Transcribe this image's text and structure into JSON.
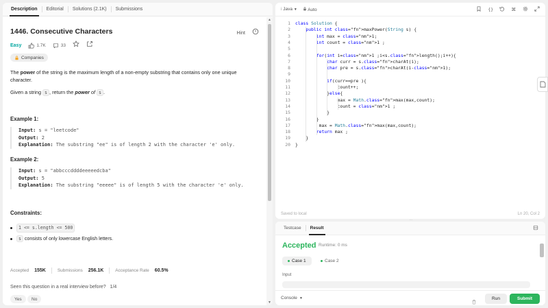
{
  "left_tabs": [
    {
      "label": "Description"
    },
    {
      "label": "Editorial"
    },
    {
      "label": "Solutions (2.1K)"
    },
    {
      "label": "Submissions"
    }
  ],
  "problem": {
    "title": "1446. Consecutive Characters",
    "hint": "Hint",
    "difficulty": "Easy",
    "likes": "1.7K",
    "comments": "33",
    "companies_chip": "Companies",
    "desc1_pre": "The ",
    "desc1_bold": "power",
    "desc1_post": " of the string is the maximum length of a non-empty substring that contains only one unique character.",
    "desc2_pre": "Given a string ",
    "desc2_code1": "s",
    "desc2_mid": ", return the ",
    "desc2_bold": "power",
    "desc2_of": " of ",
    "desc2_code2": "s",
    "desc2_end": "."
  },
  "examples": [
    {
      "heading": "Example 1:",
      "input_label": "Input:",
      "input": "s = \"leetcode\"",
      "output_label": "Output:",
      "output": "2",
      "expl_label": "Explanation:",
      "explanation": "The substring \"ee\" is of length 2 with the character 'e' only."
    },
    {
      "heading": "Example 2:",
      "input_label": "Input:",
      "input": "s = \"abbcccddddeeeeedcba\"",
      "output_label": "Output:",
      "output": "5",
      "expl_label": "Explanation:",
      "explanation": "The substring \"eeeee\" is of length 5 with the character 'e' only."
    }
  ],
  "constraints": {
    "heading": "Constraints:",
    "c1": "1 <= s.length <= 500",
    "c2_code": "s",
    "c2_text": " consists of only lowercase English letters."
  },
  "stats": {
    "accepted_label": "Accepted",
    "accepted": "155K",
    "submissions_label": "Submissions",
    "submissions": "256.1K",
    "rate_label": "Acceptance Rate",
    "rate": "60.5%"
  },
  "interview": {
    "question": "Seen this question in a real interview before?",
    "count": "1/4",
    "yes": "Yes",
    "no": "No"
  },
  "editor": {
    "language": "Java",
    "auto": "Auto",
    "saved": "Saved to local",
    "position": "Ln 20, Col 2",
    "lines": [
      "class Solution {",
      "    public int maxPower(String s) {",
      "        int max = 1;",
      "        int count = 1 ;",
      "",
      "        for(int i=1 ;i<s.length();i++){",
      "            char curr = s.charAt(i);",
      "            char pre = s.charAt(i-1);",
      "",
      "            if(curr==pre ){",
      "                count++;",
      "            }else{",
      "                max = Math.max(max,count);",
      "                count = 1 ;",
      "            }",
      "        }",
      "         max = Math.max(max,count);",
      "        return max ;",
      "    }",
      "}"
    ]
  },
  "result_panel": {
    "tabs": [
      {
        "label": "Testcase"
      },
      {
        "label": "Result"
      }
    ],
    "status": "Accepted",
    "runtime": "Runtime: 0 ms",
    "case1": "Case 1",
    "case2": "Case 2",
    "input_label": "Input",
    "console": "Console",
    "run": "Run",
    "submit": "Submit"
  },
  "colors": {
    "accepted_green": "#2db55d",
    "easy_teal": "#00a6a0"
  }
}
